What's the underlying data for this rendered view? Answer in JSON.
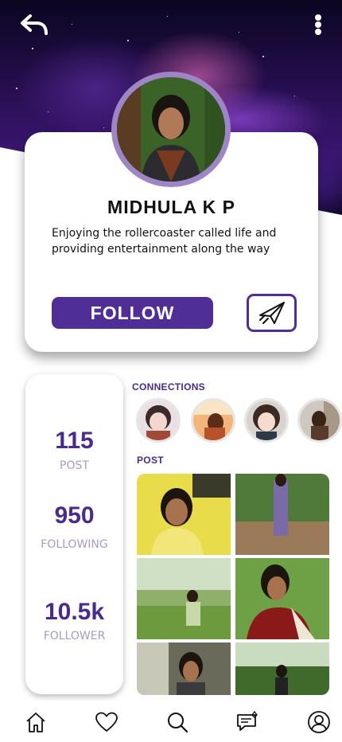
{
  "header": {
    "back_icon": "back-arrow-icon",
    "menu_icon": "more-vertical-icon"
  },
  "profile": {
    "name": "MIDHULA K P",
    "bio": "Enjoying the rollercoaster called life and providing entertainment along the way",
    "follow_label": "FOLLOW",
    "send_icon": "paper-plane-icon"
  },
  "stats": [
    {
      "value": "115",
      "label": "POST"
    },
    {
      "value": "950",
      "label": "FOLLOWING"
    },
    {
      "value": "10.5k",
      "label": "FOLLOWER"
    }
  ],
  "connections": {
    "title": "CONNECTIONS"
  },
  "posts": {
    "title": "POST"
  },
  "nav": {
    "items": [
      "home-icon",
      "heart-icon",
      "search-icon",
      "messages-icon",
      "profile-icon"
    ]
  },
  "colors": {
    "accent": "#4f2e98",
    "accent_light": "#a79ac8",
    "avatar_ring": "#9e86c6"
  }
}
